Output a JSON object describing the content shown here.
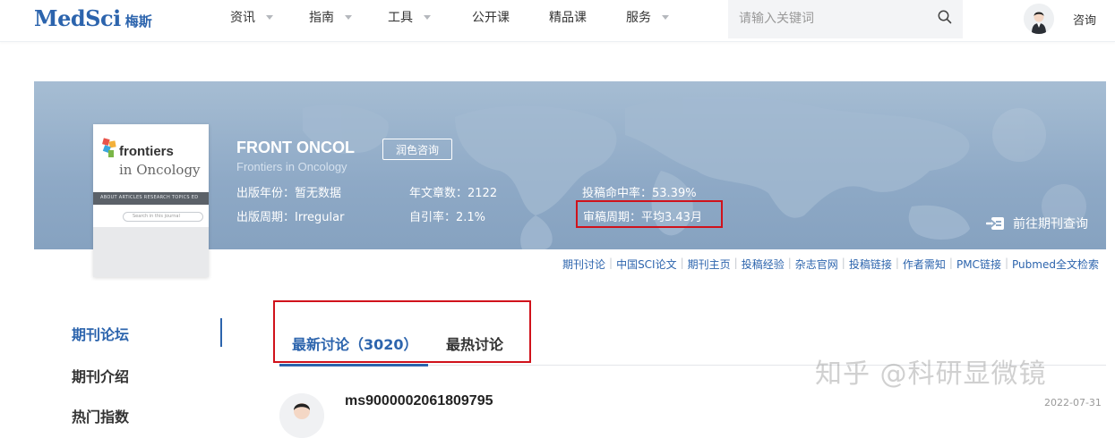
{
  "header": {
    "logo_text": "MedSci",
    "logo_cn": "梅斯",
    "nav": [
      {
        "label": "资讯",
        "has_dropdown": true
      },
      {
        "label": "指南",
        "has_dropdown": true
      },
      {
        "label": "工具",
        "has_dropdown": true
      },
      {
        "label": "公开课",
        "has_dropdown": false
      },
      {
        "label": "精品课",
        "has_dropdown": false
      },
      {
        "label": "服务",
        "has_dropdown": true
      }
    ],
    "search_placeholder": "请输入关键词",
    "search_icon": "search-icon",
    "consult_label": "咨询"
  },
  "journal": {
    "title": "FRONT ONCOL",
    "subtitle": "Frontiers in Oncology",
    "consult_button": "润色咨询",
    "cover": {
      "brand": "frontiers",
      "name": "in Oncology",
      "nav_text": "ABOUT    ARTICLES    RESEARCH TOPICS    ED",
      "search_text": "Search in this journal"
    },
    "stats": {
      "year": "出版年份：暂无数据",
      "articles": "年文章数：2122",
      "acceptance": "投稿命中率：53.39%",
      "frequency": "出版周期：Irregular",
      "self_citation": "自引率：2.1%",
      "review_cycle": "审稿周期：平均3.43月"
    },
    "go_query": "前往期刊查询"
  },
  "links": [
    "期刊讨论",
    "中国SCI论文",
    "期刊主页",
    "投稿经验",
    "杂志官网",
    "投稿链接",
    "作者需知",
    "PMC链接",
    "Pubmed全文检索"
  ],
  "sidebar": {
    "items": [
      "期刊论坛",
      "期刊介绍",
      "热门指数"
    ]
  },
  "tabs": {
    "latest": "最新讨论（3020）",
    "hottest": "最热讨论"
  },
  "post": {
    "user": "ms9000002061809795",
    "date": "2022-07-31"
  },
  "watermark": "知乎 @科研显微镜",
  "colors": {
    "brand_blue": "#2c64ad",
    "highlight_red": "#d0121b",
    "banner_blue": "#8ea9c6"
  }
}
